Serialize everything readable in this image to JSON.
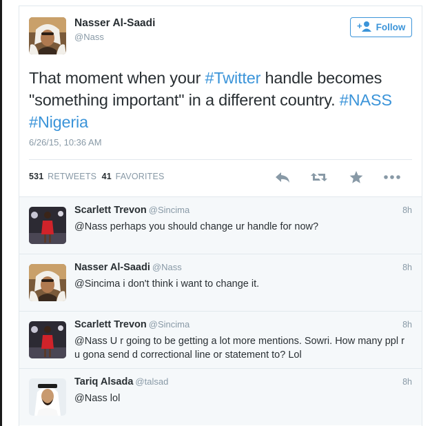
{
  "tweet": {
    "author_name": "Nasser Al-Saadi",
    "author_handle": "@Nass",
    "follow_label": "Follow",
    "text_parts": {
      "p1": "That moment when your ",
      "h1": "#Twitter",
      "p2": " handle becomes \"something important\" in a different country. ",
      "h2": "#NASS",
      "h3": "#Nigeria"
    },
    "timestamp": "6/26/15, 10:36 AM",
    "retweets_count": "531",
    "retweets_label": "RETWEETS",
    "favorites_count": "41",
    "favorites_label": "FAVORITES"
  },
  "icons": {
    "follow": "add-user-icon",
    "reply": "reply-icon",
    "retweet": "retweet-icon",
    "favorite": "star-icon",
    "more": "more-dots-icon"
  },
  "colors": {
    "accent": "#3b94d9",
    "text": "#292f33",
    "muted": "#8899a6",
    "action_icons": "#8899a6",
    "reply_background": "#f5f8fa"
  },
  "replies": [
    {
      "name": "Scarlett Trevon",
      "handle": "@Sincima",
      "time": "8h",
      "text": "@Nass  perhaps you should change ur handle for now?"
    },
    {
      "name": "Nasser Al-Saadi",
      "handle": "@Nass",
      "time": "8h",
      "text": "@Sincima i don't think i want to change it."
    },
    {
      "name": "Scarlett Trevon",
      "handle": "@Sincima",
      "time": "8h",
      "text": "@Nass U r going to be getting a lot more mentions. Sowri. How many ppl r u gona send d correctional line or statement to? Lol"
    },
    {
      "name": "Tariq Alsada",
      "handle": "@talsad",
      "time": "8h",
      "text": "@Nass lol"
    }
  ]
}
